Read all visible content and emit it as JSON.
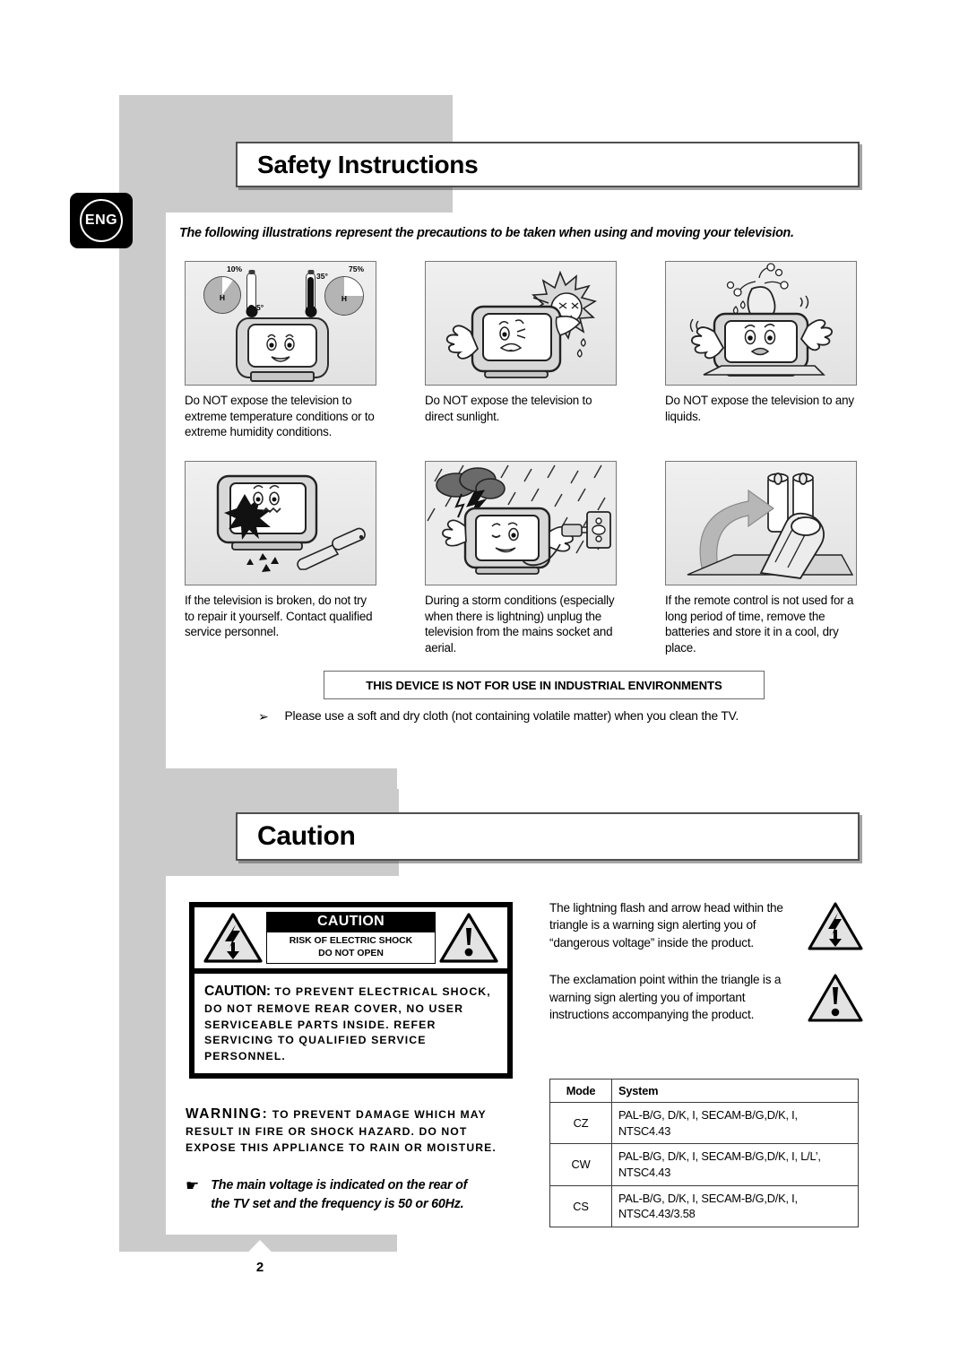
{
  "language_badge": "ENG",
  "sections": {
    "safety": {
      "title": "Safety Instructions",
      "intro": "The following illustrations represent the precautions to be taken when using and moving your television.",
      "illustrations": [
        {
          "icon": "tv-temperature-humidity-illustration",
          "caption": "Do NOT expose the television to extreme temperature conditions or to extreme humidity conditions.",
          "labels": {
            "humidity_low": "10%",
            "humidity_high": "75%",
            "temp_low": "5°",
            "temp_high": "35°",
            "pie_mark": "H"
          }
        },
        {
          "icon": "tv-direct-sunlight-illustration",
          "caption": "Do NOT expose the television to direct sunlight."
        },
        {
          "icon": "tv-liquid-spill-illustration",
          "caption": "Do NOT expose the television to any liquids."
        },
        {
          "icon": "tv-broken-screen-illustration",
          "caption": "If the television is broken, do not try to repair it yourself. Contact qualified service personnel."
        },
        {
          "icon": "tv-storm-unplug-illustration",
          "caption": "During a storm conditions (especially when there is lightning) unplug the television from the mains socket and aerial."
        },
        {
          "icon": "remote-control-batteries-illustration",
          "caption": "If the remote control is not used for a long period of time, remove the batteries and store it in a cool, dry place."
        }
      ],
      "industrial_notice": "THIS DEVICE IS NOT FOR USE IN INDUSTRIAL ENVIRONMENTS",
      "bullet_arrow": "➢",
      "bullet_text": "Please use a soft and dry cloth (not containing volatile matter) when you clean the TV."
    },
    "caution": {
      "title": "Caution",
      "label_box": {
        "heading": "CAUTION",
        "sub_line1": "RISK OF ELECTRIC SHOCK",
        "sub_line2": "DO NOT OPEN",
        "body_lead": "CAUTION:",
        "body_text": " TO PREVENT ELECTRICAL SHOCK, DO NOT REMOVE REAR COVER, NO USER SERVICEABLE PARTS INSIDE. REFER SERVICING TO QUALIFIED SERVICE PERSONNEL.",
        "left_icon": "lightning-bolt-triangle-icon",
        "right_icon": "exclamation-triangle-icon"
      },
      "warning": {
        "lead": "WARNING:",
        "text": " TO PREVENT DAMAGE WHICH MAY RESULT IN FIRE OR SHOCK HAZARD. DO NOT EXPOSE THIS APPLIANCE TO RAIN OR MOISTURE."
      },
      "voltage_note": {
        "glyph": "☛",
        "line1": "The main voltage is indicated on the rear of",
        "line2": "the TV set and the frequency is 50 or 60Hz."
      },
      "symbol_explanations": [
        {
          "text": "The lightning flash and arrow head within the triangle is a warning sign alerting you of “dangerous voltage” inside the product.",
          "icon": "lightning-bolt-triangle-icon"
        },
        {
          "text": "The exclamation point within the triangle is a warning sign alerting you of important instructions accompanying the product.",
          "icon": "exclamation-triangle-icon"
        }
      ],
      "mode_table": {
        "headers": [
          "Mode",
          "System"
        ],
        "rows": [
          {
            "mode": "CZ",
            "system": "PAL-B/G, D/K, I, SECAM-B/G,D/K, I, NTSC4.43"
          },
          {
            "mode": "CW",
            "system": "PAL-B/G, D/K, I, SECAM-B/G,D/K, I, L/L’, NTSC4.43"
          },
          {
            "mode": "CS",
            "system": "PAL-B/G, D/K, I, SECAM-B/G,D/K, I, NTSC4.43/3.58"
          }
        ]
      }
    }
  },
  "page_number": "2"
}
